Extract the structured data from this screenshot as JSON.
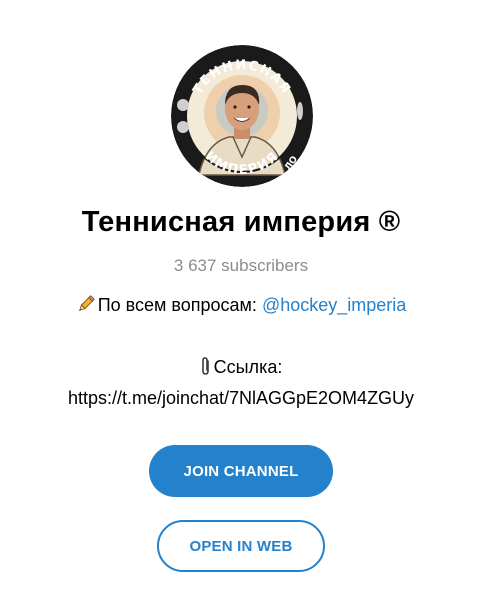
{
  "channel": {
    "title": "Теннисная империя ®",
    "subscribers": "3 637 subscribers",
    "avatar_badge": {
      "top_text": "ТЕННИСНАЯ",
      "bottom_text": "ИМПЕРИЯ",
      "side_text": "ЛО"
    }
  },
  "description": {
    "line1_emoji": "pencil-icon",
    "line1_text": "По всем вопросам: ",
    "line1_link": "@hockey_imperia",
    "line2_emoji": "paperclip-icon",
    "line2_text": "Ссылка:",
    "line3_text": "https://t.me/joinchat/7NlAGGpE2OM4ZGUy"
  },
  "buttons": {
    "join_label": "JOIN CHANNEL",
    "web_label": "OPEN IN WEB"
  },
  "colors": {
    "accent": "#2481cc",
    "muted": "#8c8c8c"
  }
}
